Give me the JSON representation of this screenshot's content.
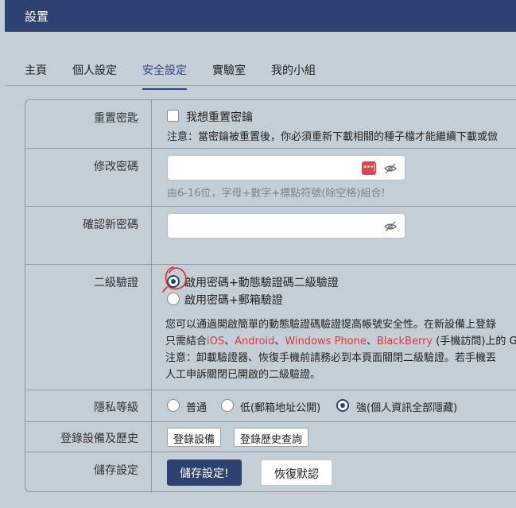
{
  "window": {
    "title": "設置"
  },
  "tabs": [
    {
      "label": "主頁",
      "active": false
    },
    {
      "label": "個人設定",
      "active": false
    },
    {
      "label": "安全設定",
      "active": true
    },
    {
      "label": "實驗室",
      "active": false
    },
    {
      "label": "我的小組",
      "active": false
    }
  ],
  "reset_key": {
    "label": "重置密匙",
    "checkbox_label": "我想重置密鑰",
    "checked": false,
    "note": "注意：當密鑰被重置後，你必須重新下載相關的種子檔才能繼續下載或倣"
  },
  "change_password": {
    "label": "修改密碼",
    "value": "",
    "hint": "由6-16位，字母+數字+標點符號(除空格)組合!",
    "badge_text": "•••|"
  },
  "confirm_password": {
    "label": "確認新密碼",
    "value": ""
  },
  "two_factor": {
    "label": "二級驗證",
    "options": [
      {
        "label": "啟用密碼+動態驗證碼二級驗證",
        "selected": true
      },
      {
        "label": "啟用密碼+郵箱驗證",
        "selected": false
      }
    ],
    "desc_line1": "您可以通過開啟簡單的動態驗證碼驗證提高帳號安全性。在新設備上登錄",
    "desc_line2": {
      "prefix": "只需結合",
      "ios": "iOS",
      "sep1": "、",
      "android": "Android",
      "sep2": "、",
      "winphone": "Windows Phone",
      "sep3": "、",
      "blackberry": "BlackBerry",
      "suffix": " (手機訪問)上的 G"
    },
    "desc_line3": "注意：卸載驗證器、恢復手機前請務必到本頁面關閉二級驗證。若手機丟",
    "desc_line4": "人工申訴關閉已開啟的二級驗證。"
  },
  "privacy": {
    "label": "隱私等級",
    "options": [
      {
        "label": "普通",
        "selected": false
      },
      {
        "label": "低(郵箱地址公開)",
        "selected": false
      },
      {
        "label": "強(個人資訊全部隱藏)",
        "selected": true
      }
    ]
  },
  "devices": {
    "label": "登錄設備及歷史",
    "buttons": [
      "登錄設備",
      "登錄歷史查詢"
    ]
  },
  "save": {
    "label": "儲存設定",
    "save_button": "儲存設定!",
    "reset_button": "恢復默認"
  },
  "colors": {
    "accent": "#2d4270",
    "link_red": "#d93b3b",
    "background": "#c3ced6"
  }
}
